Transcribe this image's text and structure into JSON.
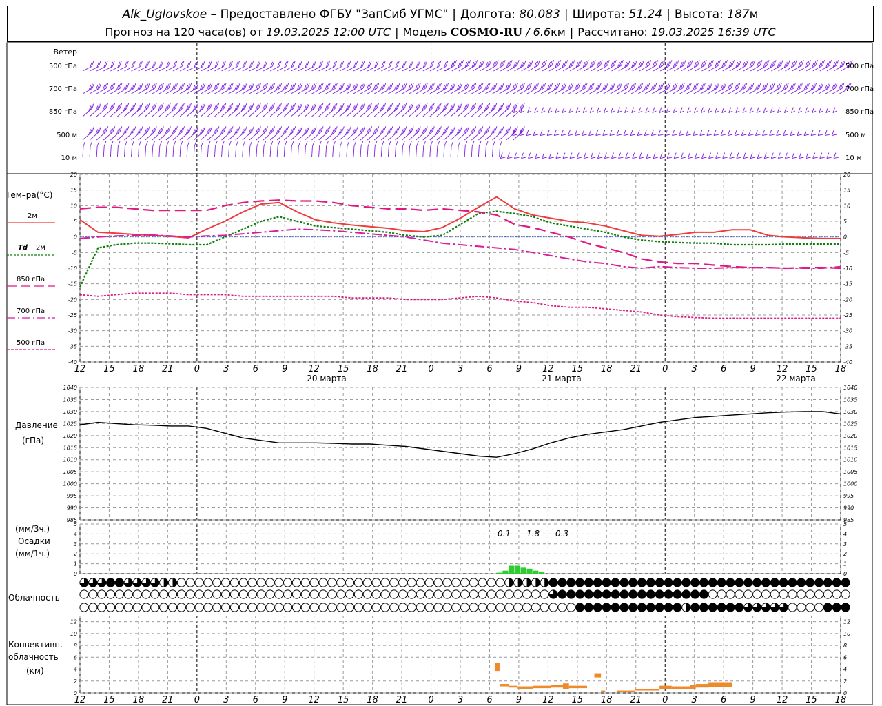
{
  "header": {
    "station": "Alk_Uglovskoe",
    "dash": " – ",
    "provider": "Предоставлено ФГБУ \"ЗапСиб УГМС\"",
    "lon_label": "Долгота:",
    "lon_value": "80.083",
    "lat_label": "Широта:",
    "lat_value": "51.24",
    "alt_label": "Высота:",
    "alt_value": "187",
    "alt_unit": "м",
    "forecast_prefix": "Прогноз на 120 часа(ов) от",
    "forecast_time": "19.03.2025 12:00 UTC",
    "model_label": "Модель",
    "model_name": "COSMO-RU",
    "model_res": "/ 6.6",
    "model_res_unit": "км",
    "calc_label": "Рассчитано:",
    "calc_time": "19.03.2025 16:39 UTC"
  },
  "colors": {
    "wind": "#7f1fdf",
    "t2m": "#ef3b3b",
    "td2m": "#0a7f0a",
    "t850": "#e0187f",
    "t700": "#d81c9a",
    "t500": "#e0187f",
    "pressure": "#000000",
    "precip": "#2ecc2e",
    "convective": "#ee8a2a",
    "grid": "#9a9a9a"
  },
  "time_axis": {
    "ticks": [
      "12",
      "15",
      "18",
      "21",
      "0",
      "3",
      "6",
      "9",
      "12",
      "15",
      "18",
      "21",
      "0",
      "3",
      "6",
      "9",
      "12",
      "15",
      "18",
      "21",
      "0",
      "3",
      "6",
      "9",
      "12",
      "15",
      "18"
    ],
    "days": [
      "20 марта",
      "21 марта",
      "22 марта"
    ]
  },
  "wind_panel": {
    "title": "Ветер",
    "levels": [
      "500 гПа",
      "700 гПа",
      "850 гПа",
      "500 м",
      "10 м"
    ]
  },
  "temp_panel": {
    "title": "Тем–ра(°С)",
    "yticks": [
      "20",
      "15",
      "10",
      "5",
      "0",
      "-5",
      "-10",
      "-15",
      "-20",
      "-25",
      "-30",
      "-35",
      "-40"
    ],
    "legend": [
      {
        "label": "2м",
        "prefix": ""
      },
      {
        "label": "2м",
        "prefix": "Td"
      },
      {
        "label": "850 гПа",
        "prefix": ""
      },
      {
        "label": "700 гПа",
        "prefix": ""
      },
      {
        "label": "500 гПа",
        "prefix": ""
      }
    ]
  },
  "pressure_panel": {
    "title": "Давление",
    "unit": "(гПа)",
    "yticks": [
      "1040",
      "1035",
      "1030",
      "1025",
      "1020",
      "1015",
      "1010",
      "1005",
      "1000",
      "995",
      "990",
      "985"
    ]
  },
  "precip_panel": {
    "unit3": "(мм/3ч.)",
    "title": "Осадки",
    "unit1": "(мм/1ч.)",
    "yticks": [
      "5",
      "4",
      "3",
      "2",
      "1",
      "0"
    ],
    "labels": [
      "0.1",
      "1.8",
      "0.3"
    ]
  },
  "cloud_panel": {
    "title": "Облачность"
  },
  "convective_panel": {
    "title1": "Конвективн.",
    "title2": "облачность",
    "unit": "(км)",
    "yticks": [
      "12",
      "10",
      "8",
      "6",
      "4",
      "2",
      "0"
    ]
  },
  "chart_data": [
    {
      "type": "line",
      "name": "temperature",
      "x_hours": [
        0,
        3,
        6,
        9,
        12,
        15,
        18,
        21,
        24,
        27,
        30,
        33,
        36,
        39,
        42,
        45,
        48,
        51,
        54,
        57,
        60,
        63,
        66,
        69,
        72,
        75,
        78,
        81,
        84,
        87,
        90,
        93,
        96,
        99,
        102,
        105,
        108,
        111,
        114,
        117,
        120,
        123,
        126
      ],
      "ylim": [
        -40,
        20
      ],
      "series": [
        {
          "name": "2м",
          "values": [
            5.5,
            1.5,
            1.2,
            0.8,
            0.5,
            0.2,
            -0.3,
            2.5,
            5,
            8,
            10.5,
            11,
            8,
            5.5,
            4.5,
            3.8,
            3.3,
            2.8,
            2,
            1.7,
            3,
            6,
            9.5,
            12.8,
            9,
            7,
            6,
            5,
            4.5,
            3.5,
            2,
            0.5,
            0.2,
            0.8,
            1.5,
            1.5,
            2.3,
            2.3,
            0.5,
            0,
            -0.3,
            -0.5,
            -0.5
          ]
        },
        {
          "name": "Td 2м",
          "values": [
            -16,
            -3.5,
            -2.5,
            -2,
            -2,
            -2.2,
            -2.5,
            -2.5,
            0,
            2.5,
            5,
            6.5,
            5,
            3.5,
            3,
            2.5,
            2,
            1.5,
            0.5,
            0,
            0.5,
            4,
            7.5,
            8.2,
            7.5,
            6.5,
            4.5,
            3.5,
            2.5,
            1.5,
            0,
            -1,
            -1.5,
            -1.8,
            -2,
            -2,
            -2.5,
            -2.5,
            -2.5,
            -2.3,
            -2.3,
            -2.3,
            -2.3
          ]
        },
        {
          "name": "850 гПа",
          "values": [
            9,
            9.5,
            9.5,
            9,
            8.5,
            8.5,
            8.5,
            8.5,
            10,
            11,
            11.5,
            11.8,
            11.5,
            11.5,
            11,
            10,
            9.5,
            9,
            9,
            8.5,
            9,
            8.5,
            8,
            7,
            4,
            3,
            1.5,
            0,
            -2,
            -3.5,
            -5,
            -7,
            -8,
            -8.5,
            -8.5,
            -9,
            -9.5,
            -9.8,
            -9.8,
            -10,
            -9.8,
            -9.8,
            -10
          ]
        },
        {
          "name": "700 гПа",
          "values": [
            -0.5,
            0,
            0.3,
            0.5,
            0.6,
            0.3,
            0,
            0.3,
            0.5,
            1,
            1.5,
            2,
            2.5,
            2.3,
            2,
            1.5,
            1,
            0.5,
            0,
            -1,
            -2,
            -2.5,
            -3,
            -3.5,
            -4,
            -5,
            -6,
            -7,
            -8,
            -8.5,
            -9.5,
            -10,
            -9.5,
            -9.8,
            -10,
            -10,
            -9.8,
            -9.8,
            -9.8,
            -10,
            -10,
            -10,
            -9.5
          ]
        },
        {
          "name": "500 гПа",
          "values": [
            -18.5,
            -19,
            -18.5,
            -18,
            -18,
            -18,
            -18.5,
            -18.5,
            -18.5,
            -19,
            -19,
            -19,
            -19,
            -19,
            -19,
            -19.5,
            -19.5,
            -19.5,
            -20,
            -20,
            -20,
            -19.5,
            -19,
            -19.5,
            -20.5,
            -21,
            -22,
            -22.5,
            -22.5,
            -23,
            -23.5,
            -24,
            -25,
            -25.5,
            -25.8,
            -26,
            -26,
            -26,
            -26,
            -26,
            -26,
            -26,
            -26
          ]
        }
      ]
    },
    {
      "type": "line",
      "name": "pressure",
      "x_hours": [
        0,
        3,
        6,
        9,
        12,
        15,
        18,
        21,
        24,
        27,
        30,
        33,
        36,
        39,
        42,
        45,
        48,
        51,
        54,
        57,
        60,
        63,
        66,
        69,
        72,
        75,
        78,
        81,
        84,
        87,
        90,
        93,
        96,
        99,
        102,
        105,
        108,
        111,
        114,
        117,
        120,
        123,
        126
      ],
      "ylim": [
        985,
        1040
      ],
      "series": [
        {
          "name": "pressure",
          "values": [
            1024.5,
            1025.5,
            1025,
            1024.5,
            1024.3,
            1024,
            1024,
            1023,
            1021,
            1019,
            1018,
            1017,
            1017,
            1017,
            1016.8,
            1016.5,
            1016.5,
            1016,
            1015.5,
            1014.5,
            1013.5,
            1012.5,
            1011.5,
            1011,
            1012.5,
            1014.5,
            1017,
            1019,
            1020.5,
            1021.5,
            1022.5,
            1024,
            1025.5,
            1026.5,
            1027.5,
            1028,
            1028.5,
            1029,
            1029.5,
            1029.8,
            1030,
            1030,
            1029
          ]
        }
      ]
    },
    {
      "type": "bar",
      "name": "precipitation",
      "x_hours": [
        66,
        67,
        68,
        69,
        70,
        71,
        72,
        73,
        74,
        75,
        76,
        77,
        78,
        79
      ],
      "ylim": [
        0,
        5
      ],
      "values": [
        0,
        0,
        0,
        0.1,
        0.3,
        0.8,
        0.8,
        0.6,
        0.5,
        0.3,
        0.2,
        0,
        0,
        0
      ],
      "labels_3h": [
        {
          "hour": 66,
          "text": "0.1"
        },
        {
          "hour": 69,
          "text": "1.8"
        },
        {
          "hour": 72,
          "text": "0.3"
        }
      ]
    },
    {
      "type": "bar",
      "name": "convective cloud",
      "ylim": [
        0,
        13
      ],
      "bars": [
        {
          "x0": 68.7,
          "x1": 69.5,
          "bottom": 3.7,
          "top": 5.0
        },
        {
          "x0": 69.5,
          "x1": 71.0,
          "bottom": 1.1,
          "top": 1.5
        },
        {
          "x0": 71.0,
          "x1": 72.5,
          "bottom": 0.9,
          "top": 1.2
        },
        {
          "x0": 72.5,
          "x1": 75.0,
          "bottom": 0.7,
          "top": 1.1
        },
        {
          "x0": 75.0,
          "x1": 78.0,
          "bottom": 0.8,
          "top": 1.2
        },
        {
          "x0": 78.0,
          "x1": 80.0,
          "bottom": 0.9,
          "top": 1.3
        },
        {
          "x0": 80.0,
          "x1": 81.0,
          "bottom": 0.6,
          "top": 1.6
        },
        {
          "x0": 81.0,
          "x1": 84.0,
          "bottom": 0.8,
          "top": 1.2
        },
        {
          "x0": 85.2,
          "x1": 86.3,
          "bottom": 2.6,
          "top": 3.3
        },
        {
          "x0": 86.3,
          "x1": 87.0,
          "bottom": 0.2,
          "top": 0.4
        },
        {
          "x0": 89.0,
          "x1": 92.0,
          "bottom": 0.2,
          "top": 0.4
        },
        {
          "x0": 92.0,
          "x1": 96.0,
          "bottom": 0.4,
          "top": 0.7
        },
        {
          "x0": 96.0,
          "x1": 98.0,
          "bottom": 0.6,
          "top": 1.2
        },
        {
          "x0": 98.0,
          "x1": 101.0,
          "bottom": 0.6,
          "top": 1.1
        },
        {
          "x0": 101.0,
          "x1": 102.0,
          "bottom": 0.7,
          "top": 1.3
        },
        {
          "x0": 102.0,
          "x1": 104.0,
          "bottom": 0.9,
          "top": 1.5
        },
        {
          "x0": 104.0,
          "x1": 105.0,
          "bottom": 1.0,
          "top": 1.8
        },
        {
          "x0": 105.0,
          "x1": 108.0,
          "bottom": 1.0,
          "top": 1.8
        }
      ]
    },
    {
      "type": "table",
      "name": "cloudiness",
      "start_hour": 0,
      "step_hours": 1.15,
      "rows": [
        {
          "layer": "upper",
          "runs": [
            [
              0,
              2,
              "partial"
            ],
            [
              3,
              4,
              "full"
            ],
            [
              5,
              8,
              "partial"
            ],
            [
              9,
              10,
              "half"
            ],
            [
              11,
              47,
              "none"
            ],
            [
              48,
              52,
              "half"
            ],
            [
              53,
              54,
              "full"
            ],
            [
              55,
              94,
              "full"
            ],
            [
              95,
              96,
              "half"
            ],
            [
              97,
              108,
              "none"
            ]
          ]
        },
        {
          "layer": "middle",
          "runs": [
            [
              0,
              52,
              "none"
            ],
            [
              53,
              53,
              "partial"
            ],
            [
              54,
              70,
              "full"
            ],
            [
              71,
              108,
              "none"
            ]
          ]
        },
        {
          "layer": "lower",
          "runs": [
            [
              0,
              55,
              "none"
            ],
            [
              56,
              67,
              "full"
            ],
            [
              68,
              68,
              "half"
            ],
            [
              69,
              74,
              "full"
            ],
            [
              75,
              79,
              "partial"
            ],
            [
              80,
              83,
              "none"
            ],
            [
              84,
              96,
              "full"
            ],
            [
              97,
              97,
              "half"
            ],
            [
              98,
              108,
              "none"
            ]
          ]
        }
      ]
    },
    {
      "type": "scatter",
      "name": "wind barbs",
      "levels": [
        "500 гПа",
        "700 гПа",
        "850 гПа",
        "500 м",
        "10 м"
      ],
      "x_hours_step": 1,
      "speed_ms": [
        {
          "level": "500 гПа",
          "segments": [
            [
              0,
              60,
              "weak-west"
            ],
            [
              60,
              126,
              "moderate-west"
            ]
          ]
        },
        {
          "level": "700 гПа",
          "segments": [
            [
              0,
              126,
              "moderate-west"
            ]
          ]
        },
        {
          "level": "850 гПа",
          "segments": [
            [
              0,
              72,
              "moderate-southwest"
            ],
            [
              72,
              126,
              "light-north"
            ]
          ]
        },
        {
          "level": "500 м",
          "segments": [
            [
              0,
              72,
              "moderate-southwest"
            ],
            [
              72,
              126,
              "light-northwest"
            ]
          ]
        },
        {
          "level": "10 м",
          "segments": [
            [
              0,
              70,
              "light-south"
            ],
            [
              70,
              126,
              "light-northwest"
            ]
          ]
        }
      ]
    }
  ]
}
